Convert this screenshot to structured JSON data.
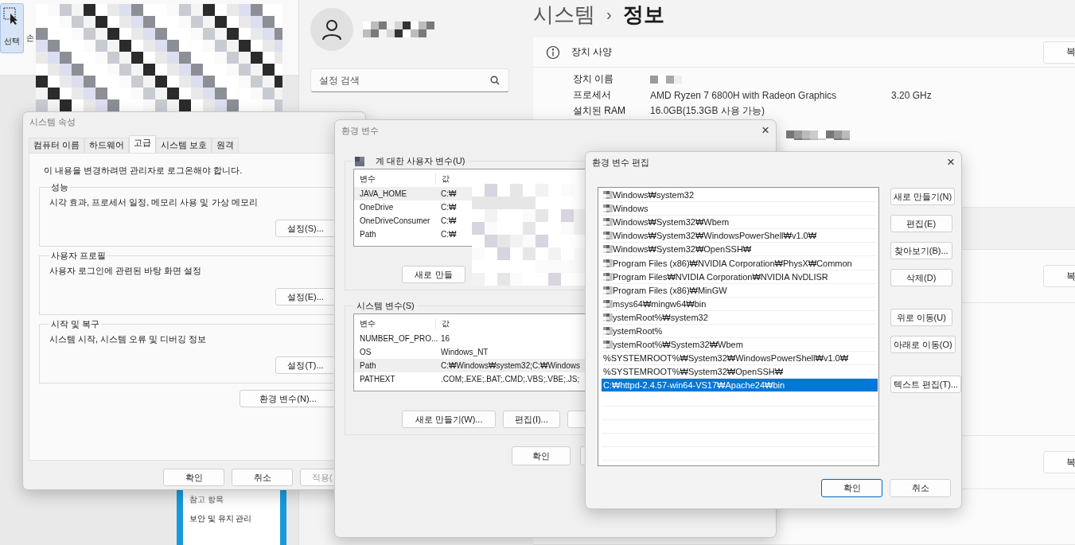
{
  "paint": {
    "select_tool": {
      "label": "선택",
      "selected": true
    },
    "partial_label": "손"
  },
  "side_panel": {
    "heading": "참고 항목",
    "link": "보안 및 유지 관리"
  },
  "settings": {
    "search": {
      "placeholder": "설정 검색"
    },
    "breadcrumb": {
      "parent": "시스템",
      "separator": "›",
      "current": "정보"
    },
    "device_specs": {
      "title": "장치 사양",
      "button": "복",
      "rows": [
        {
          "label": "장치 이름",
          "kind": "redacted"
        },
        {
          "label": "프로세서",
          "kind": "text",
          "value": "AMD Ryzen 7 6800H with Radeon Graphics",
          "extra": "3.20 GHz"
        },
        {
          "label": "설치된 RAM",
          "kind": "text",
          "value": "16.0GB(15.3GB 사용 가능)"
        }
      ]
    },
    "card_buttons": [
      "복",
      "복"
    ]
  },
  "system_properties": {
    "title": "시스템 속성",
    "tabs": [
      {
        "label": "컴퓨터 이름",
        "selected": false
      },
      {
        "label": "하드웨어",
        "selected": false
      },
      {
        "label": "고급",
        "selected": true
      },
      {
        "label": "시스템 보호",
        "selected": false
      },
      {
        "label": "원격",
        "selected": false
      }
    ],
    "notice": "이 내용을 변경하려면 관리자로 로그온해야 합니다.",
    "groups": [
      {
        "title": "성능",
        "description": "시각 효과, 프로세서 일정, 메모리 사용 및 가상 메모리",
        "button": "설정(S)..."
      },
      {
        "title": "사용자 프로필",
        "description": "사용자 로그인에 관련된 바탕 화면 설정",
        "button": "설정(E)..."
      },
      {
        "title": "시작 및 복구",
        "description": "시스템 시작, 시스템 오류 및 디버깅 정보",
        "button": "설정(T)..."
      }
    ],
    "env_button": "환경 변수(N)...",
    "footer": [
      {
        "label": "확인",
        "disabled": false
      },
      {
        "label": "취소",
        "disabled": false
      },
      {
        "label": "적용(",
        "disabled": true
      }
    ]
  },
  "environment_variables": {
    "title": "환경 변수",
    "close": "×",
    "user_group": {
      "title": "계 대한 사용자 변수(U)",
      "columns": [
        "변수",
        "값"
      ],
      "rows": [
        {
          "name": "JAVA_HOME",
          "value": "C:₩",
          "selected": true
        },
        {
          "name": "OneDrive",
          "value": "C:₩",
          "selected": false
        },
        {
          "name": "OneDriveConsumer",
          "value": "C:₩",
          "selected": false
        },
        {
          "name": "Path",
          "value": "C:₩",
          "selected": false
        }
      ],
      "buttons": [
        "새로 만들"
      ]
    },
    "system_group": {
      "title": "시스템 변수(S)",
      "columns": [
        "변수",
        "값"
      ],
      "rows": [
        {
          "name": "NUMBER_OF_PRO...",
          "value": "16",
          "selected": false
        },
        {
          "name": "OS",
          "value": "Windows_NT",
          "selected": false
        },
        {
          "name": "Path",
          "value": "C:₩Windows₩system32;C:₩Windows",
          "selected": true
        },
        {
          "name": "PATHEXT",
          "value": ".COM;.EXE;.BAT;.CMD;.VBS;.VBE;.JS;",
          "selected": false
        }
      ],
      "buttons": [
        "새로 만들기(W)...",
        "편집(I)..."
      ]
    },
    "footer": [
      "확인"
    ]
  },
  "edit_dialog": {
    "title": "환경 변수 편집",
    "close": "×",
    "entries": [
      {
        "text": "Windows₩system32",
        "masked": true,
        "selected": false
      },
      {
        "text": "Windows",
        "masked": true,
        "selected": false
      },
      {
        "text": "Windows₩System32₩Wbem",
        "masked": true,
        "selected": false
      },
      {
        "text": "Windows₩System32₩WindowsPowerShell₩v1.0₩",
        "masked": true,
        "selected": false
      },
      {
        "text": "Windows₩System32₩OpenSSH₩",
        "masked": true,
        "selected": false
      },
      {
        "text": "Program Files (x86)₩NVIDIA Corporation₩PhysX₩Common",
        "masked": true,
        "selected": false
      },
      {
        "text": "Program Files₩NVIDIA Corporation₩NVIDIA NvDLISR",
        "masked": true,
        "selected": false
      },
      {
        "text": "Program Files (x86)₩MinGW",
        "masked": true,
        "selected": false
      },
      {
        "text": "msys64₩mingw64₩bin",
        "masked": true,
        "selected": false
      },
      {
        "text": "ystemRoot%₩system32",
        "masked": true,
        "selected": false
      },
      {
        "text": "ystemRoot%",
        "masked": true,
        "selected": false
      },
      {
        "text": "ystemRoot%₩System32₩Wbem",
        "masked": true,
        "selected": false
      },
      {
        "text": "%SYSTEMROOT%₩System32₩WindowsPowerShell₩v1.0₩",
        "masked": false,
        "selected": false
      },
      {
        "text": "%SYSTEMROOT%₩System32₩OpenSSH₩",
        "masked": false,
        "selected": false
      },
      {
        "text": "C:₩httpd-2.4.57-win64-VS17₩Apache24₩bin",
        "masked": false,
        "selected": true
      }
    ],
    "button_groups": [
      [
        "새로 만들기(N)",
        "편집(E)",
        "찾아보기(B)...",
        "삭제(D)"
      ],
      [
        "위로 이동(U)",
        "아래로 이동(O)"
      ],
      [
        "텍스트 편집(T)..."
      ]
    ],
    "footer": [
      {
        "label": "확인",
        "default": true
      },
      {
        "label": "취소",
        "default": false
      }
    ]
  }
}
